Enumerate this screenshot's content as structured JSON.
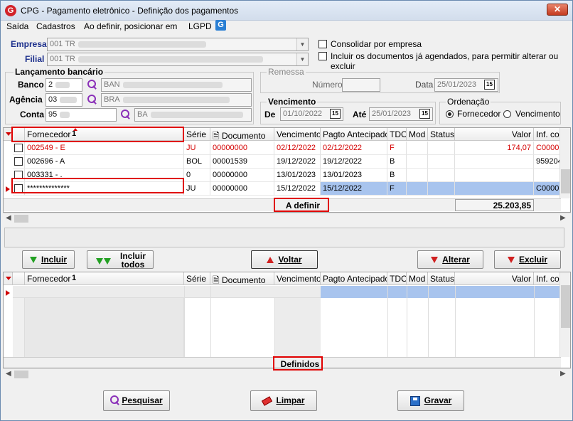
{
  "window": {
    "title": "CPG - Pagamento eletrônico - Definição dos pagamentos",
    "logo": "G",
    "close": "✕"
  },
  "menu": [
    "Saída",
    "Cadastros",
    "Ao definir, posicionar em",
    "LGPD"
  ],
  "empresa": {
    "label": "Empresa",
    "value": "001 TR"
  },
  "filial": {
    "label": "Filial",
    "value": "001 TR"
  },
  "options": {
    "consolidar": "Consolidar por empresa",
    "incluir": "Incluir os documentos já agendados, para permitir alterar ou excluir"
  },
  "lancamento": {
    "title": "Lançamento bancário",
    "banco_label": "Banco",
    "banco_code": "2",
    "banco_name": "BAN",
    "agencia_label": "Agência",
    "agencia_code": "03",
    "agencia_name": "BRA",
    "conta_label": "Conta",
    "conta_code": "95",
    "conta_name": "BA"
  },
  "remessa": {
    "title": "Remessa",
    "numero_label": "Número",
    "numero_value": "",
    "data_label": "Data",
    "data_value": "25/01/2023"
  },
  "vencimento": {
    "title": "Vencimento",
    "de_label": "De",
    "de_value": "01/10/2022",
    "ate_label": "Até",
    "ate_value": "25/01/2023"
  },
  "ordenacao": {
    "title": "Ordenação",
    "opt1": "Fornecedor",
    "opt2": "Vencimento",
    "selected": "Fornecedor"
  },
  "columns": [
    "Fornecedor",
    "Série",
    "Documento",
    "Vencimento",
    "Pagto Antecipado",
    "TDO",
    "Mod",
    "Status",
    "Valor",
    "Inf. cor"
  ],
  "sort_indicator": "1",
  "grid1": {
    "rows": [
      {
        "fornecedor": "002549 - E",
        "serie": "JU",
        "documento": "00000000",
        "vencimento": "02/12/2022",
        "pagto": "02/12/2022",
        "tdo": "F",
        "mod": "",
        "status": "",
        "valor": "174,07",
        "inf": "C0000",
        "red": true
      },
      {
        "fornecedor": "002696 - A",
        "serie": "BOL",
        "documento": "00001539",
        "vencimento": "19/12/2022",
        "pagto": "19/12/2022",
        "tdo": "B",
        "mod": "",
        "status": "",
        "valor": "",
        "inf": "959204",
        "red": false
      },
      {
        "fornecedor": "003331 - .",
        "serie": "0",
        "documento": "00000000",
        "vencimento": "13/01/2023",
        "pagto": "13/01/2023",
        "tdo": "B",
        "mod": "",
        "status": "",
        "valor": "",
        "inf": "",
        "red": false
      },
      {
        "fornecedor": "**************",
        "serie": "JU",
        "documento": "00000000",
        "vencimento": "15/12/2022",
        "pagto": "15/12/2022",
        "tdo": "F",
        "mod": "",
        "status": "",
        "valor": "",
        "inf": "C0000",
        "red": false,
        "selected": true
      }
    ],
    "footer": "A definir",
    "total": "25.203,85"
  },
  "buttons": {
    "incluir": "Incluir",
    "incluir_todos_1": "Incluir",
    "incluir_todos_2": "todos",
    "voltar": "Voltar",
    "alterar": "Alterar",
    "excluir": "Excluir"
  },
  "grid2": {
    "footer": "Definidos"
  },
  "bottom_buttons": {
    "pesquisar": "Pesquisar",
    "limpar": "Limpar",
    "gravar": "Gravar"
  },
  "colors": {
    "accent_red": "#e00000",
    "selection": "#a8c4ee",
    "label_blue": "#1c2f8c"
  }
}
